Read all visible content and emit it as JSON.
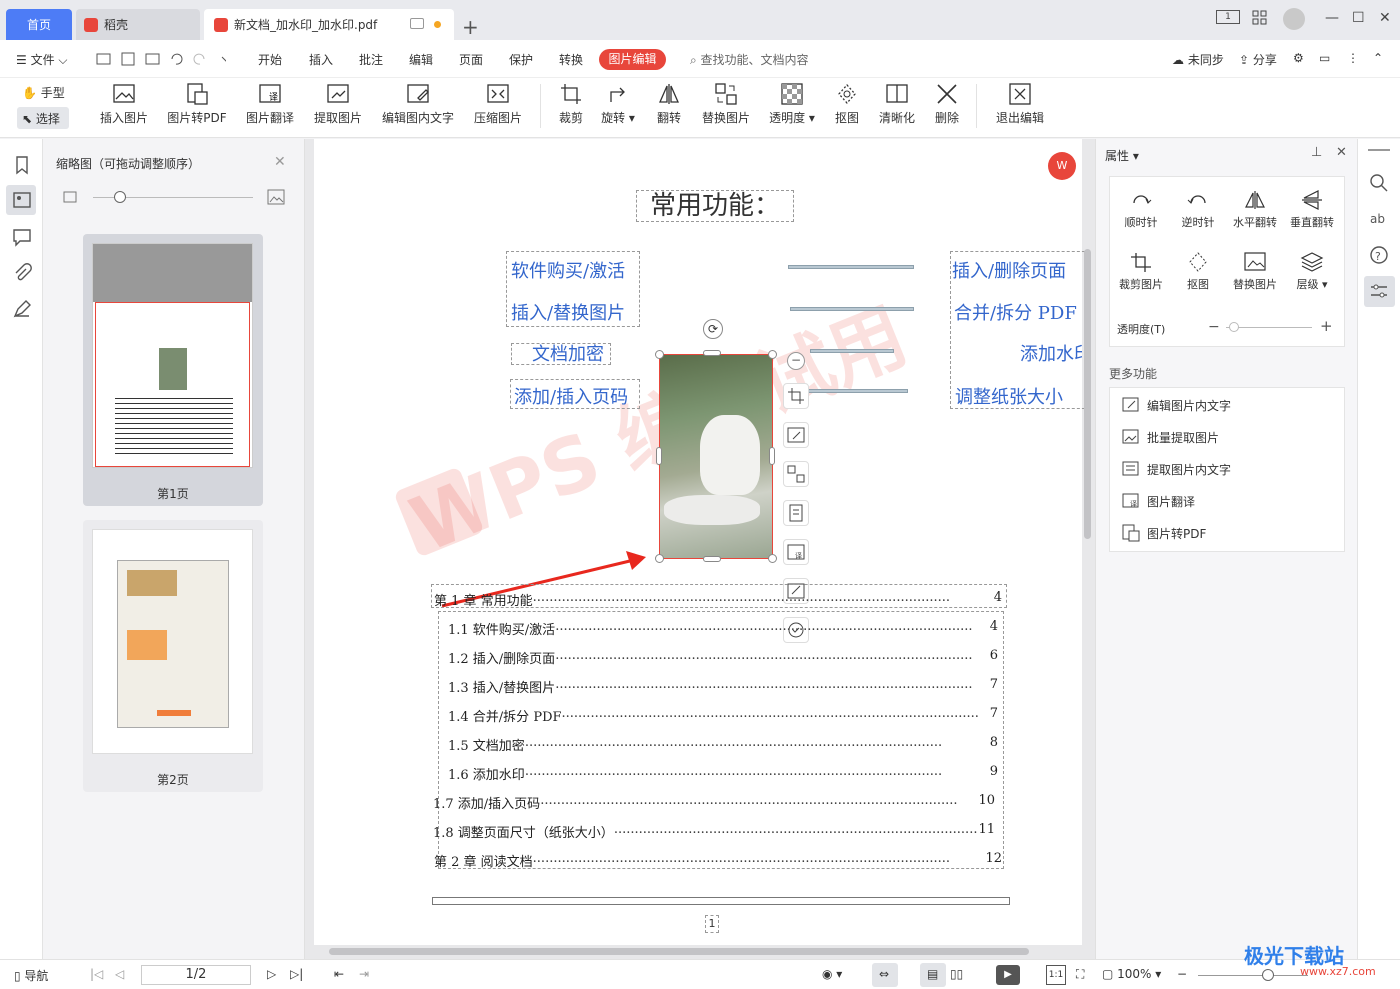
{
  "tabs": {
    "home": "首页",
    "daoke": "稻壳",
    "doc": "新文档_加水印_加水印.pdf"
  },
  "menu": {
    "file": "文件",
    "items": [
      "开始",
      "插入",
      "批注",
      "编辑",
      "页面",
      "保护",
      "转换"
    ],
    "active": "图片编辑",
    "search_placeholder": "查找功能、文档内容",
    "unsynced": "未同步",
    "share": "分享"
  },
  "toolbar": {
    "hand": "手型",
    "select": "选择",
    "buttons": [
      "插入图片",
      "图片转PDF",
      "图片翻译",
      "提取图片",
      "编辑图内文字",
      "压缩图片",
      "裁剪",
      "旋转",
      "翻转",
      "替换图片",
      "透明度",
      "抠图",
      "清晰化",
      "删除",
      "退出编辑"
    ]
  },
  "thumbnails": {
    "title": "缩略图（可拖动调整顺序）",
    "pages": [
      "第1页",
      "第2页"
    ]
  },
  "document": {
    "heading": "常用功能：",
    "left_links": [
      "软件购买/激活",
      "插入/替换图片",
      "文档加密",
      "添加/插入页码"
    ],
    "right_links": [
      "插入/删除页面",
      "合并/拆分 PDF",
      "添加水印",
      "调整纸张大小"
    ],
    "watermark": "WPS 编辑试用",
    "toc": [
      {
        "label": "第  1  章    常用功能",
        "page": "4"
      },
      {
        "label": "1.1  软件购买/激活",
        "page": "4"
      },
      {
        "label": "1.2   插入/删除页面",
        "page": "6"
      },
      {
        "label": "1.3   插入/替换图片",
        "page": "7"
      },
      {
        "label": "1.4   合并/拆分   PDF",
        "page": "7"
      },
      {
        "label": "1.5   文档加密",
        "page": "8"
      },
      {
        "label": "1.6   添加水印",
        "page": "9"
      },
      {
        "label": "1.7 添加/插入页码",
        "page": "10"
      },
      {
        "label": "1.8  调整页面尺寸（纸张大小）",
        "page": "11"
      },
      {
        "label": "第  2  章    阅读文档",
        "page": "12"
      }
    ],
    "page_number": "1"
  },
  "properties": {
    "title": "属性",
    "tools": [
      "顺时针",
      "逆时针",
      "水平翻转",
      "垂直翻转",
      "裁剪图片",
      "抠图",
      "替换图片",
      "层级"
    ],
    "opacity_label": "透明度(T)",
    "more_title": "更多功能",
    "more": [
      "编辑图片内文字",
      "批量提取图片",
      "提取图片内文字",
      "图片翻译",
      "图片转PDF"
    ]
  },
  "status": {
    "nav": "导航",
    "page_indicator": "1/2",
    "zoom": "100%"
  },
  "corner_watermark": "极光下载站",
  "corner_watermark_url": "www.xz7.com",
  "colors": {
    "accent_blue": "#4d7cf6",
    "accent_red": "#e8463b",
    "link_blue": "#3366cc"
  }
}
